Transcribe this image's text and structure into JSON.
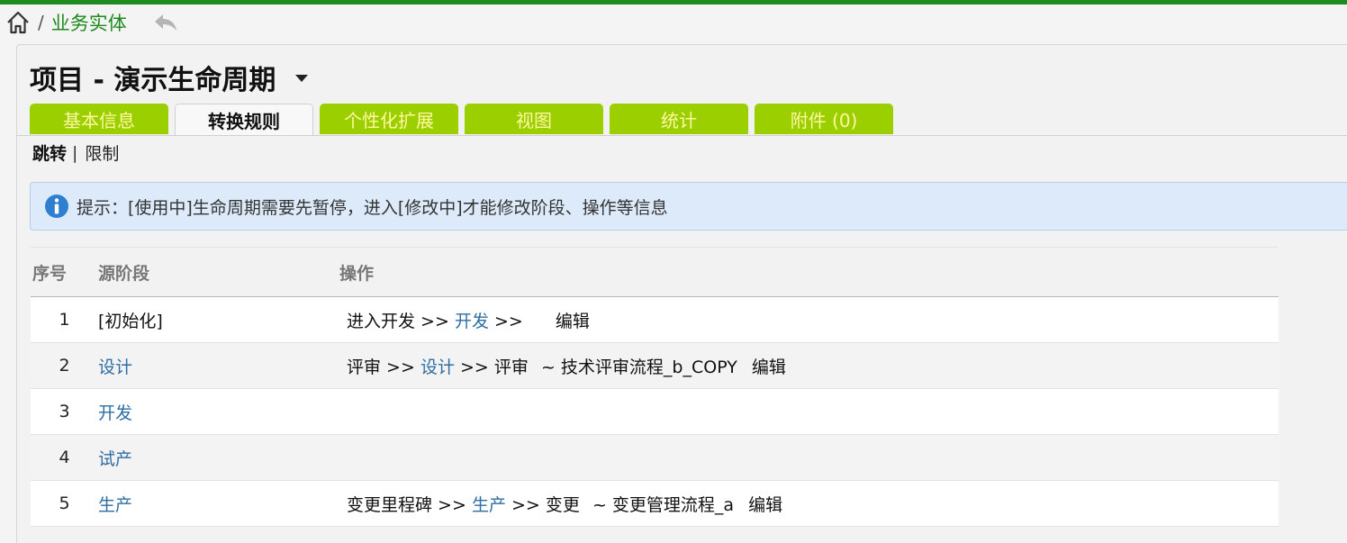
{
  "breadcrumb": {
    "separator": "/",
    "current": "业务实体"
  },
  "page": {
    "title": "项目 - 演示生命周期"
  },
  "tabs": [
    {
      "label": "基本信息"
    },
    {
      "label": "转换规则"
    },
    {
      "label": "个性化扩展"
    },
    {
      "label": "视图"
    },
    {
      "label": "统计"
    },
    {
      "label": "附件 (0)"
    }
  ],
  "subnav": {
    "current": "跳转",
    "separator": "|",
    "other": "限制"
  },
  "notice": {
    "text": "提示：[使用中]生命周期需要先暂停，进入[修改中]才能修改阶段、操作等信息"
  },
  "table": {
    "headers": {
      "index": "序号",
      "source": "源阶段",
      "operation": "操作"
    },
    "rows": [
      {
        "index": "1",
        "source": "[初始化]",
        "op_name": "进入开发 >>",
        "op_target": "开发",
        "op_sep": ">>",
        "op_action": "",
        "op_tilde": "",
        "op_flow": "",
        "op_edit": "编辑"
      },
      {
        "index": "2",
        "source": "设计",
        "op_name": "评审 >>",
        "op_target": "设计",
        "op_sep": ">>",
        "op_action": "评审",
        "op_tilde": "~",
        "op_flow": "技术评审流程_b_COPY",
        "op_edit": "编辑"
      },
      {
        "index": "3",
        "source": "开发",
        "op_name": "",
        "op_target": "",
        "op_sep": "",
        "op_action": "",
        "op_tilde": "",
        "op_flow": "",
        "op_edit": ""
      },
      {
        "index": "4",
        "source": "试产",
        "op_name": "",
        "op_target": "",
        "op_sep": "",
        "op_action": "",
        "op_tilde": "",
        "op_flow": "",
        "op_edit": ""
      },
      {
        "index": "5",
        "source": "生产",
        "op_name": "变更里程碑 >>",
        "op_target": "生产",
        "op_sep": ">>",
        "op_action": "变更",
        "op_tilde": "~",
        "op_flow": "变更管理流程_a",
        "op_edit": "编辑"
      }
    ]
  },
  "colors": {
    "brand_green": "#1f8a1f",
    "tab_green": "#9ccf00",
    "tab_text": "#fff8a0",
    "link_blue": "#2e6da4",
    "notice_bg": "#ddeaf9"
  },
  "icons": {
    "home": "home-icon",
    "back": "back-arrow-icon",
    "info": "info-icon",
    "caret": "chevron-down-icon"
  }
}
